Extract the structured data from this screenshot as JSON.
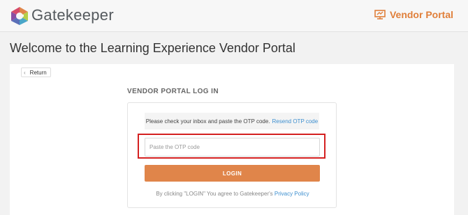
{
  "header": {
    "brand": "Gatekeeper",
    "portal_link": "Vendor Portal",
    "logo_icon": "gatekeeper-hexagon-logo",
    "portal_icon": "presentation-board-icon",
    "accent_color": "#e07f3a"
  },
  "page": {
    "title": "Welcome to the Learning Experience Vendor Portal",
    "return_label": "Return",
    "return_icon": "chevron-left-icon"
  },
  "login": {
    "heading": "VENDOR PORTAL LOG IN",
    "notice_text": "Please check your inbox and paste the OTP code.",
    "resend_link": "Resend OTP code",
    "otp_value": "",
    "otp_placeholder": "Paste the OTP code",
    "button_label": "LOGIN",
    "terms_text": "By clicking \"LOGIN\" You agree to Gatekeeper's",
    "privacy_link": "Privacy Policy"
  }
}
